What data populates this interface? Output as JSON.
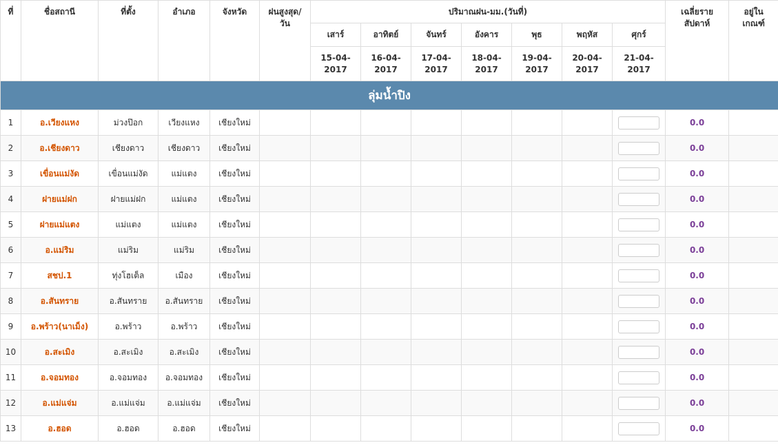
{
  "header": {
    "no": "ที่",
    "station": "ชื่อสถานี",
    "location": "ที่ตั้ง",
    "district": "อำเภอ",
    "province": "จังหวัด",
    "max_rain_line1": "ฝนสูงสุด/",
    "max_rain_line2": "วัน",
    "rain_amount": "ปริมาณฝน-มม.(วันที่)",
    "avg_line1": "เฉลี่ยราย",
    "avg_line2": "สัปดาห์",
    "criteria_line1": "อยู่ใน",
    "criteria_line2": "เกณฑ์",
    "days": [
      "เสาร์",
      "อาทิตย์",
      "จันทร์",
      "อังคาร",
      "พุธ",
      "พฤหัส",
      "ศุกร์"
    ],
    "dates": [
      {
        "d": "15-04-",
        "y": "2017"
      },
      {
        "d": "16-04-",
        "y": "2017"
      },
      {
        "d": "17-04-",
        "y": "2017"
      },
      {
        "d": "18-04-",
        "y": "2017"
      },
      {
        "d": "19-04-",
        "y": "2017"
      },
      {
        "d": "20-04-",
        "y": "2017"
      },
      {
        "d": "21-04-",
        "y": "2017"
      }
    ]
  },
  "basin": "ลุ่มน้ำปิง",
  "rows": [
    {
      "no": "1",
      "station": "อ.เวียงแหง",
      "location": "ม่วงป๊อก",
      "district": "เวียงแหง",
      "province": "เชียงใหม่",
      "avg": "0.0",
      "input": ""
    },
    {
      "no": "2",
      "station": "อ.เชียงดาว",
      "location": "เชียงดาว",
      "district": "เชียงดาว",
      "province": "เชียงใหม่",
      "avg": "0.0",
      "input": ""
    },
    {
      "no": "3",
      "station": "เขื่อนแม่งัด",
      "location": "เขื่อนแม่งัด",
      "district": "แม่แตง",
      "province": "เชียงใหม่",
      "avg": "0.0",
      "input": ""
    },
    {
      "no": "4",
      "station": "ฝายแม่ฝก",
      "location": "ฝายแม่ฝก",
      "district": "แม่แตง",
      "province": "เชียงใหม่",
      "avg": "0.0",
      "input": ""
    },
    {
      "no": "5",
      "station": "ฝายแม่แตง",
      "location": "แม่แตง",
      "district": "แม่แตง",
      "province": "เชียงใหม่",
      "avg": "0.0",
      "input": ""
    },
    {
      "no": "6",
      "station": "อ.แม่ริม",
      "location": "แม่ริม",
      "district": "แม่ริม",
      "province": "เชียงใหม่",
      "avg": "0.0",
      "input": ""
    },
    {
      "no": "7",
      "station": "สชป.1",
      "location": "ทุ่งโฮเต็ล",
      "district": "เมือง",
      "province": "เชียงใหม่",
      "avg": "0.0",
      "input": ""
    },
    {
      "no": "8",
      "station": "อ.สันทราย",
      "location": "อ.สันทราย",
      "district": "อ.สันทราย",
      "province": "เชียงใหม่",
      "avg": "0.0",
      "input": ""
    },
    {
      "no": "9",
      "station": "อ.พร้าว(นาเม็ง)",
      "location": "อ.พร้าว",
      "district": "อ.พร้าว",
      "province": "เชียงใหม่",
      "avg": "0.0",
      "input": ""
    },
    {
      "no": "10",
      "station": "อ.สะเมิง",
      "location": "อ.สะเมิง",
      "district": "อ.สะเมิง",
      "province": "เชียงใหม่",
      "avg": "0.0",
      "input": ""
    },
    {
      "no": "11",
      "station": "อ.จอมทอง",
      "location": "อ.จอมทอง",
      "district": "อ.จอมทอง",
      "province": "เชียงใหม่",
      "avg": "0.0",
      "input": ""
    },
    {
      "no": "12",
      "station": "อ.แม่แจ่ม",
      "location": "อ.แม่แจ่ม",
      "district": "อ.แม่แจ่ม",
      "province": "เชียงใหม่",
      "avg": "0.0",
      "input": ""
    },
    {
      "no": "13",
      "station": "อ.ฮอด",
      "location": "อ.ฮอด",
      "district": "อ.ฮอด",
      "province": "เชียงใหม่",
      "avg": "0.0",
      "input": ""
    }
  ],
  "colors": {
    "basin_bg": "#5b89ad",
    "station_name": "#d35400",
    "weekly_avg": "#7b3f98"
  }
}
